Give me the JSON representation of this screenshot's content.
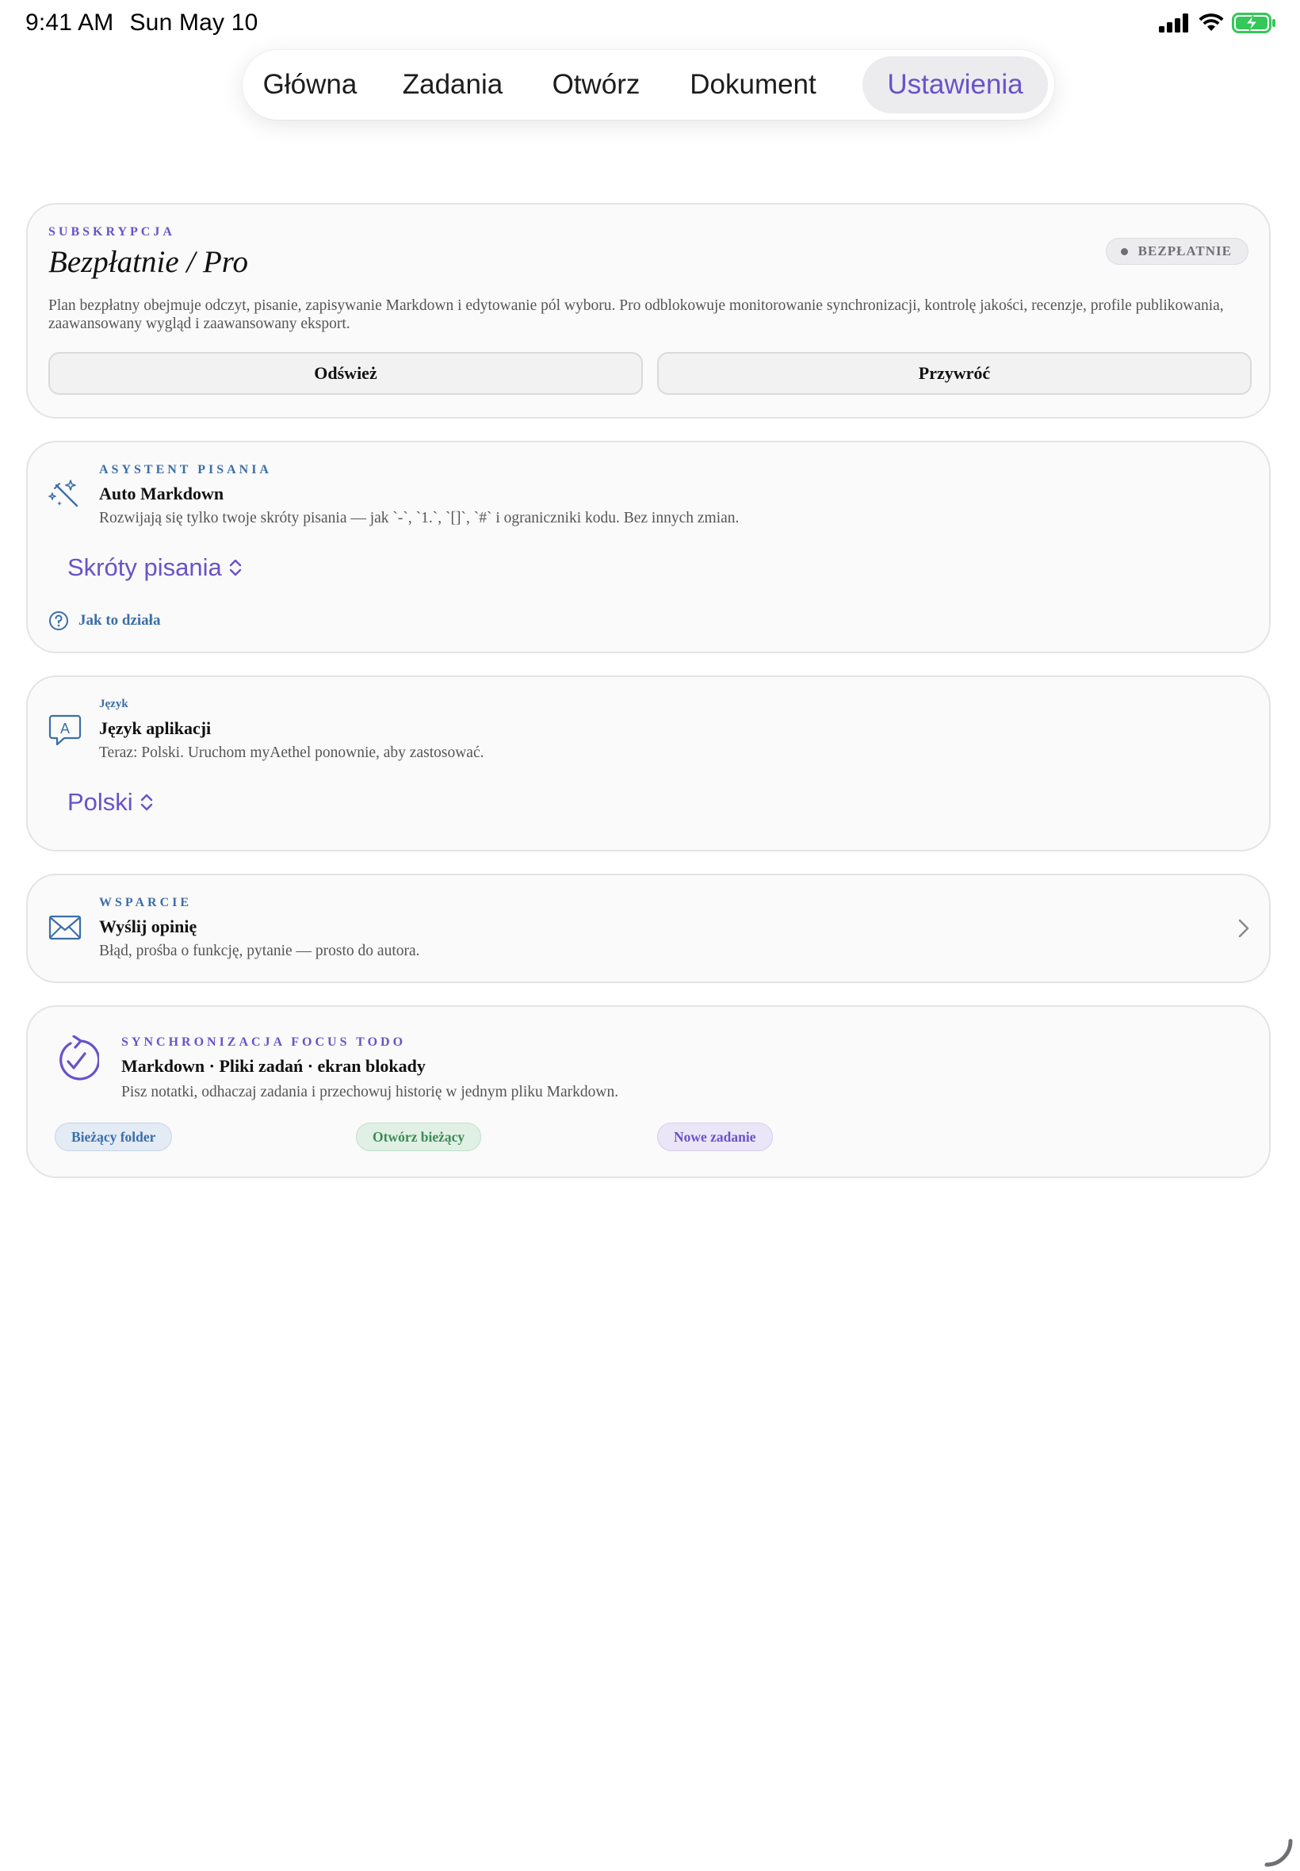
{
  "status_bar": {
    "time": "9:41 AM",
    "date": "Sun May 10"
  },
  "tabs": [
    {
      "label": "Główna",
      "active": false
    },
    {
      "label": "Zadania",
      "active": false
    },
    {
      "label": "Otwórz",
      "active": false
    },
    {
      "label": "Dokument",
      "active": false
    },
    {
      "label": "Ustawienia",
      "active": true
    }
  ],
  "colors": {
    "accent": "#6a52c8",
    "blue_accent": "#3b6ea8",
    "green_accent": "#3d8a55"
  },
  "subscription": {
    "eyebrow": "SUBSKRYPCJA",
    "title": "Bezpłatnie / Pro",
    "badge": "BEZPŁATNIE",
    "description": "Plan bezpłatny obejmuje odczyt, pisanie, zapisywanie Markdown i edytowanie pól wyboru. Pro odblokowuje monitorowanie synchronizacji, kontrolę jakości, recenzje, profile publikowania, zaawansowany wygląd i zaawansowany eksport.",
    "refresh_button": "Odśwież",
    "restore_button": "Przywróć"
  },
  "writing_assistant": {
    "icon": "magic-wand-icon",
    "eyebrow": "ASYSTENT PISANIA",
    "title": "Auto Markdown",
    "description": "Rozwijają się tylko twoje skróty pisania — jak `-`, `1.`, `[]`, `#` i ograniczniki kodu. Bez innych zmian.",
    "picker_value": "Skróty pisania",
    "help_link": "Jak to działa"
  },
  "language": {
    "icon": "speech-bubble-a-icon",
    "eyebrow": "Język",
    "title": "Język aplikacji",
    "description": "Teraz: Polski. Uruchom myAethel ponownie, aby zastosować.",
    "picker_value": "Polski"
  },
  "support": {
    "icon": "envelope-icon",
    "eyebrow": "WSPARCIE",
    "title": "Wyślij opinię",
    "description": "Błąd, prośba o funkcję, pytanie — prosto do autora."
  },
  "focus_sync": {
    "icon": "sync-check-icon",
    "eyebrow": "SYNCHRONIZACJA FOCUS TODO",
    "title": "Markdown · Pliki zadań · ekran blokady",
    "description": "Pisz notatki, odhaczaj zadania i przechowuj historię w jednym pliku Markdown.",
    "chips": [
      "Bieżący folder",
      "Otwórz bieżący",
      "Nowe zadanie"
    ]
  }
}
